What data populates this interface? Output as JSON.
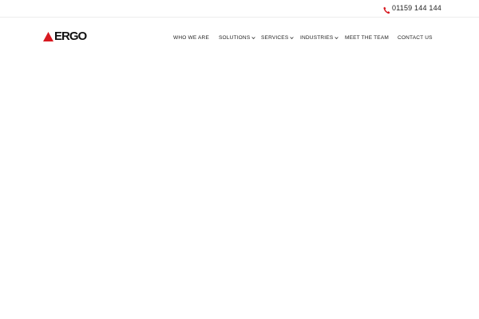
{
  "topbar": {
    "phone_icon": "phone-icon",
    "phone_number": "01159 144 144"
  },
  "header": {
    "logo_text": "ERGO",
    "logo_icon": "red-triangle-icon",
    "brand_color": "#d71920"
  },
  "nav": {
    "items": [
      {
        "label": "WHO WE ARE",
        "has_dropdown": false
      },
      {
        "label": "SOLUTIONS",
        "has_dropdown": true
      },
      {
        "label": "SERVICES",
        "has_dropdown": true
      },
      {
        "label": "INDUSTRIES",
        "has_dropdown": true
      },
      {
        "label": "MEET THE TEAM",
        "has_dropdown": false
      },
      {
        "label": "CONTACT US",
        "has_dropdown": false
      }
    ]
  }
}
